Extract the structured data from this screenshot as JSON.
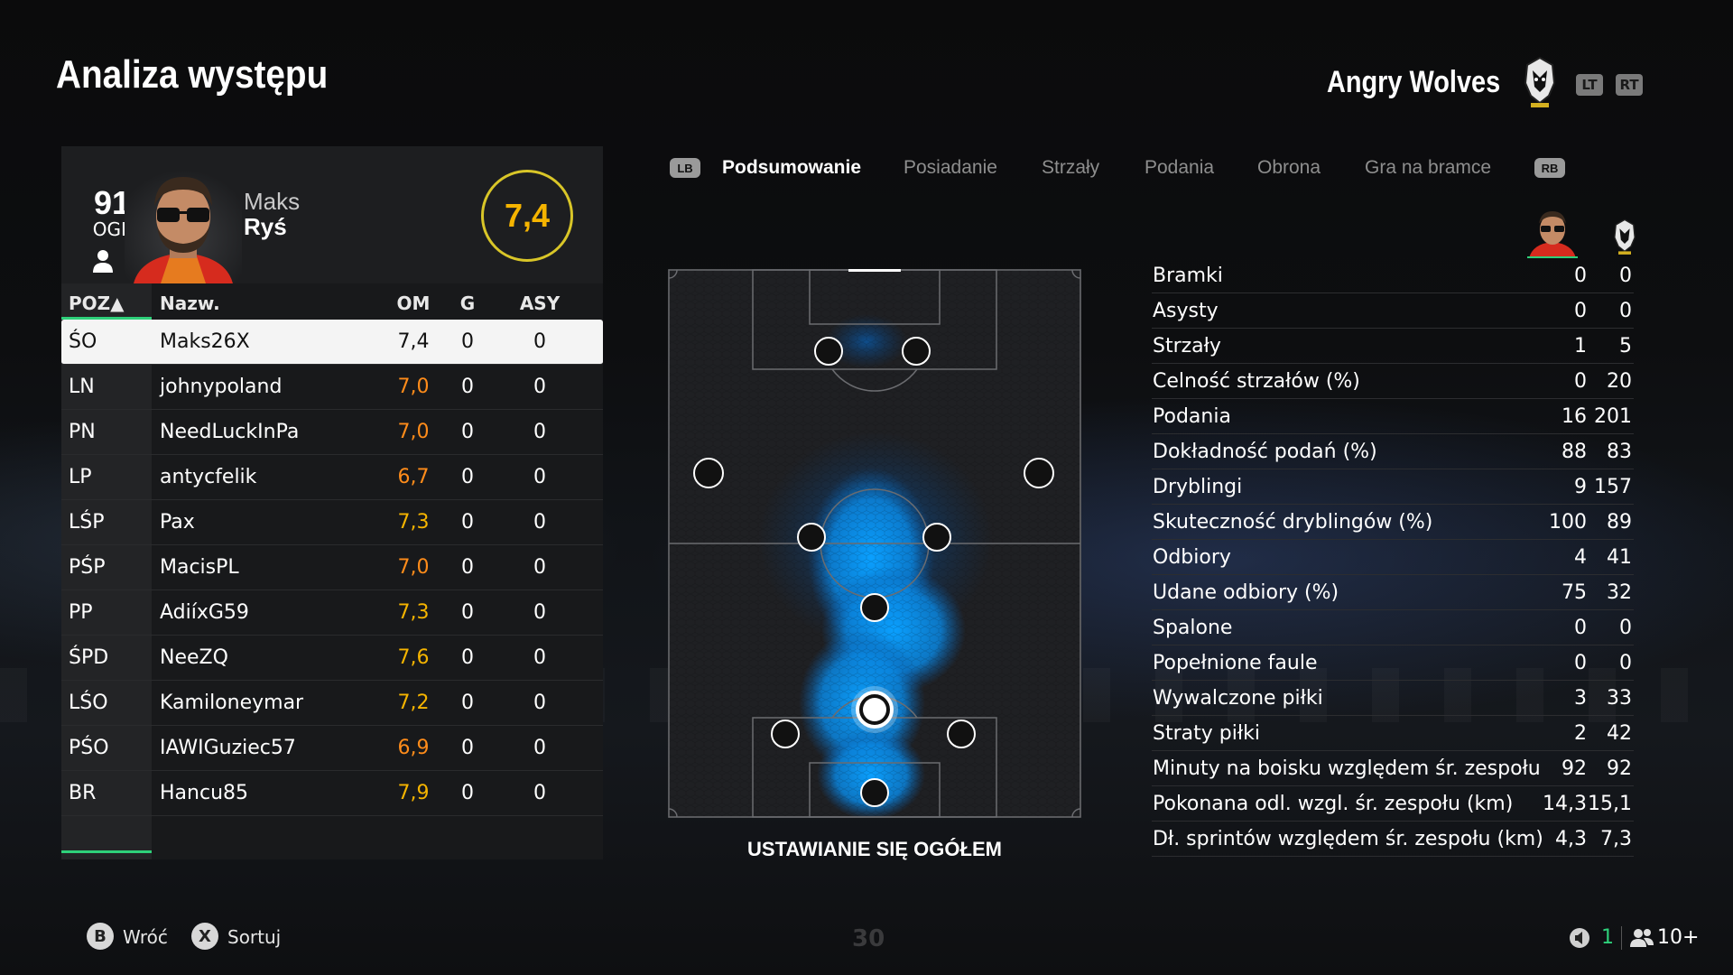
{
  "title": "Analiza występu",
  "team": {
    "name": "Angry Wolves",
    "lt": "LT",
    "rt": "RT"
  },
  "player": {
    "overall": "91",
    "overall_label": "OGL",
    "first_name": "Maks",
    "last_name": "Ryś",
    "rating": "7,4"
  },
  "table": {
    "headers": {
      "pos": "POZ▲",
      "name": "Nazw.",
      "om": "OM",
      "g": "G",
      "asy": "ASY"
    },
    "rows": [
      {
        "pos": "ŚO",
        "name": "Maks26X",
        "om": "7,4",
        "g": "0",
        "a": "0"
      },
      {
        "pos": "LN",
        "name": "johnypoland",
        "om": "7,0",
        "g": "0",
        "a": "0"
      },
      {
        "pos": "PN",
        "name": "NeedLuckInPa",
        "om": "7,0",
        "g": "0",
        "a": "0"
      },
      {
        "pos": "LP",
        "name": "antycfelik",
        "om": "6,7",
        "g": "0",
        "a": "0"
      },
      {
        "pos": "LŚP",
        "name": "Pax",
        "om": "7,3",
        "g": "0",
        "a": "0"
      },
      {
        "pos": "PŚP",
        "name": "MacisPL",
        "om": "7,0",
        "g": "0",
        "a": "0"
      },
      {
        "pos": "PP",
        "name": "AdiíxG59",
        "om": "7,3",
        "g": "0",
        "a": "0"
      },
      {
        "pos": "ŚPD",
        "name": "NeeZQ",
        "om": "7,6",
        "g": "0",
        "a": "0"
      },
      {
        "pos": "LŚO",
        "name": "Kamiloneymar",
        "om": "7,2",
        "g": "0",
        "a": "0"
      },
      {
        "pos": "PŚO",
        "name": "IAWIGuziec57",
        "om": "6,9",
        "g": "0",
        "a": "0"
      },
      {
        "pos": "BR",
        "name": "Hancu85",
        "om": "7,9",
        "g": "0",
        "a": "0"
      }
    ]
  },
  "tabs": {
    "lb": "LB",
    "rb": "RB",
    "items": [
      "Podsumowanie",
      "Posiadanie",
      "Strzały",
      "Podania",
      "Obrona",
      "Gra na bramce"
    ],
    "active": "Podsumowanie"
  },
  "pitch": {
    "caption": "USTAWIANIE SIĘ OGÓŁEM"
  },
  "stats": [
    {
      "label": "Bramki",
      "a": "0",
      "b": "0"
    },
    {
      "label": "Asysty",
      "a": "0",
      "b": "0"
    },
    {
      "label": "Strzały",
      "a": "1",
      "b": "5"
    },
    {
      "label": "Celność strzałów (%)",
      "a": "0",
      "b": "20"
    },
    {
      "label": "Podania",
      "a": "16",
      "b": "201"
    },
    {
      "label": "Dokładność podań (%)",
      "a": "88",
      "b": "83"
    },
    {
      "label": "Dryblingi",
      "a": "9",
      "b": "157"
    },
    {
      "label": "Skuteczność dryblingów (%)",
      "a": "100",
      "b": "89"
    },
    {
      "label": "Odbiory",
      "a": "4",
      "b": "41"
    },
    {
      "label": "Udane odbiory (%)",
      "a": "75",
      "b": "32"
    },
    {
      "label": "Spalone",
      "a": "0",
      "b": "0"
    },
    {
      "label": "Popełnione faule",
      "a": "0",
      "b": "0"
    },
    {
      "label": "Wywalczone piłki",
      "a": "3",
      "b": "33"
    },
    {
      "label": "Straty piłki",
      "a": "2",
      "b": "42"
    },
    {
      "label": "Minuty na boisku względem śr. zespołu",
      "a": "92",
      "b": "92"
    },
    {
      "label": "Pokonana odl. wzgl. śr. zespołu (km)",
      "a": "14,3",
      "b": "15,1"
    },
    {
      "label": "Dł. sprintów względem śr. zespołu (km)",
      "a": "4,3",
      "b": "7,3"
    }
  ],
  "footer": {
    "back_key": "B",
    "back_label": "Wróć",
    "sort_key": "X",
    "sort_label": "Sortuj",
    "timer": "30",
    "voice_count": "1",
    "party_count": "10+"
  },
  "colors": {
    "accent_green": "#2ed07a",
    "rating_yellow": "#f5b400",
    "rating_orange": "#ff8c1a",
    "heat_blue": "#0aa0ff"
  }
}
